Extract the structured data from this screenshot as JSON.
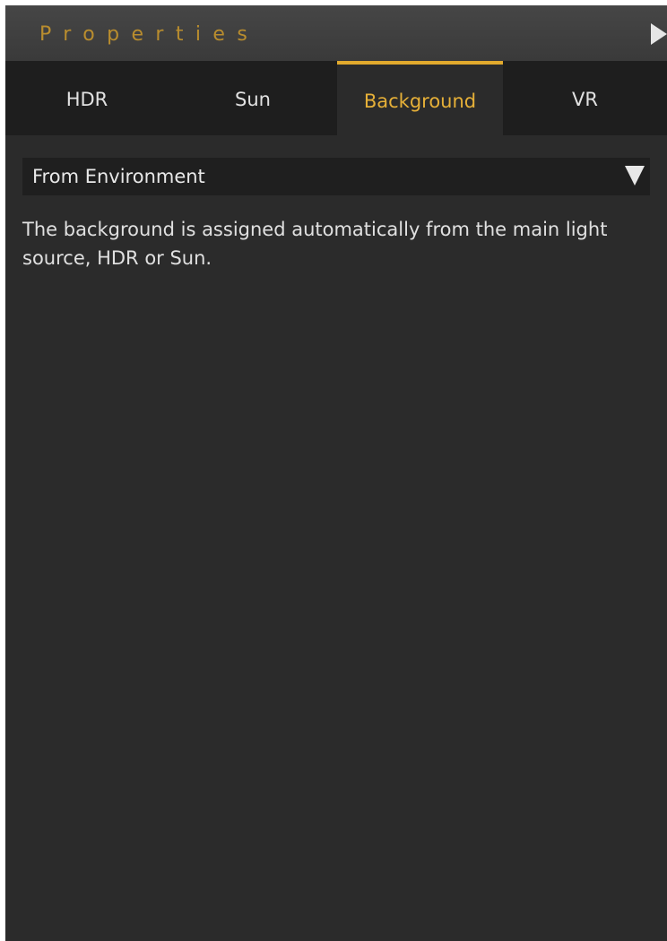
{
  "panel": {
    "title": "Properties",
    "collapse_icon": "triangle-right-icon"
  },
  "tabs": [
    {
      "label": "HDR",
      "active": false
    },
    {
      "label": "Sun",
      "active": false
    },
    {
      "label": "Background",
      "active": true
    },
    {
      "label": "VR",
      "active": false
    }
  ],
  "background": {
    "mode_select": {
      "selected": "From Environment",
      "icon": "triangle-down-icon"
    },
    "description": "The background is assigned automatically from the main light source, HDR or Sun."
  },
  "colors": {
    "accent": "#e2aa2d",
    "title": "#b98d2e",
    "panel_bg": "#2b2b2b",
    "tab_bg": "#1e1e1e"
  }
}
